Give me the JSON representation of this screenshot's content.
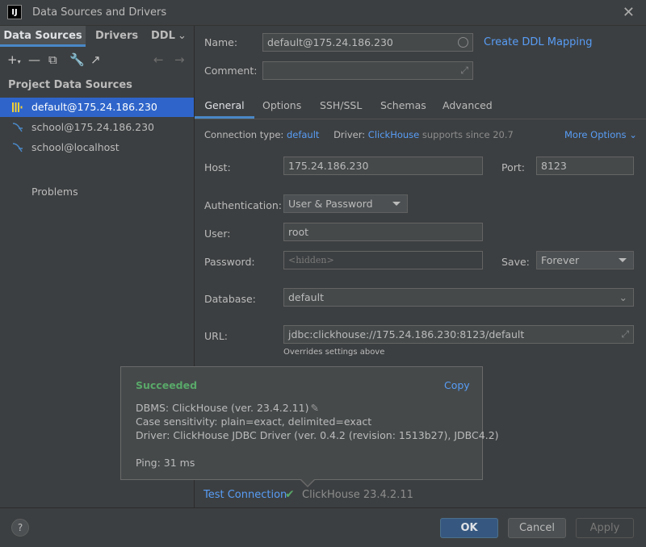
{
  "window": {
    "title": "Data Sources and Drivers",
    "logo_text": "IJ"
  },
  "left": {
    "tabs": [
      {
        "label": "Data Sources"
      },
      {
        "label": "Drivers"
      },
      {
        "label": "DDL"
      }
    ],
    "heading": "Project Data Sources",
    "items": [
      {
        "label": "default@175.24.186.230",
        "icon": "clickhouse-icon",
        "selected": true
      },
      {
        "label": "school@175.24.186.230",
        "icon": "mysql-icon"
      },
      {
        "label": "school@localhost",
        "icon": "mysql-icon"
      }
    ],
    "problems": "Problems"
  },
  "right": {
    "name_label": "Name:",
    "name_value": "default@175.24.186.230",
    "create_ddl": "Create DDL Mapping",
    "comment_label": "Comment:",
    "tabs": [
      "General",
      "Options",
      "SSH/SSL",
      "Schemas",
      "Advanced"
    ],
    "conn_type_label": "Connection type:",
    "conn_type_value": "default",
    "driver_label": "Driver:",
    "driver_value": "ClickHouse",
    "driver_note": "supports since 20.7",
    "more_options": "More Options",
    "host_label": "Host:",
    "host_value": "175.24.186.230",
    "port_label": "Port:",
    "port_value": "8123",
    "auth_label": "Authentication:",
    "auth_value": "User & Password",
    "user_label": "User:",
    "user_value": "root",
    "password_label": "Password:",
    "password_placeholder": "<hidden>",
    "save_label": "Save:",
    "save_value": "Forever",
    "database_label": "Database:",
    "database_value": "default",
    "url_label": "URL:",
    "url_value": "jdbc:clickhouse://175.24.186.230:8123/default",
    "url_note": "Overrides settings above"
  },
  "popup": {
    "status": "Succeeded",
    "copy": "Copy",
    "line1": "DBMS: ClickHouse (ver. 23.4.2.11)",
    "line2": "Case sensitivity: plain=exact, delimited=exact",
    "line3": "Driver: ClickHouse JDBC Driver (ver. 0.4.2 (revision: 1513b27), JDBC4.2)",
    "line4": "Ping: 31 ms"
  },
  "test": {
    "label": "Test Connection",
    "result": "ClickHouse 23.4.2.11"
  },
  "buttons": {
    "help": "?",
    "ok": "OK",
    "cancel": "Cancel",
    "apply": "Apply"
  },
  "colors": {
    "accent": "#4a88c7",
    "link": "#589df6",
    "success": "#59a869",
    "selected": "#2f65ca"
  }
}
